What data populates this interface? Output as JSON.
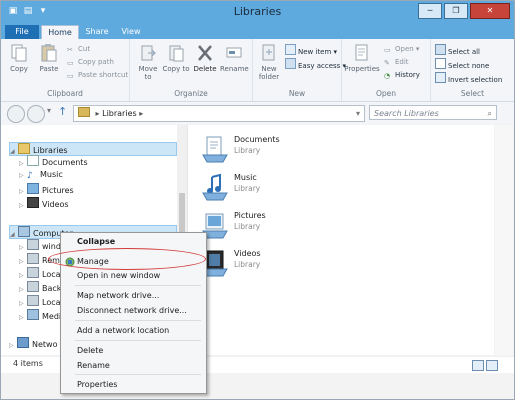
{
  "window": {
    "title": "Libraries"
  },
  "qat": {
    "items": [
      "qat-icon-1",
      "qat-icon-2",
      "qat-icon-3"
    ]
  },
  "window_controls": {
    "minimize": "─",
    "maximize": "❐",
    "close": "✕"
  },
  "tabs": {
    "file": "File",
    "home": "Home",
    "share": "Share",
    "view": "View"
  },
  "ribbon": {
    "clipboard": {
      "label": "Clipboard",
      "copy": "Copy",
      "paste": "Paste",
      "cut": "Cut",
      "copy_path": "Copy path",
      "paste_shortcut": "Paste shortcut"
    },
    "organize": {
      "label": "Organize",
      "move_to": "Move to",
      "copy_to": "Copy to",
      "delete": "Delete",
      "rename": "Rename"
    },
    "new": {
      "label": "New",
      "new_folder": "New folder",
      "new_item": "New item ▾",
      "easy_access": "Easy access ▾"
    },
    "open": {
      "label": "Open",
      "properties": "Properties",
      "open": "Open ▾",
      "edit": "Edit",
      "history": "History"
    },
    "select": {
      "label": "Select",
      "select_all": "Select all",
      "select_none": "Select none",
      "invert_selection": "Invert selection"
    }
  },
  "address": {
    "path": "Libraries",
    "search_placeholder": "Search Libraries"
  },
  "nav": {
    "libraries": "Libraries",
    "documents": "Documents",
    "music": "Music",
    "pictures": "Pictures",
    "videos": "Videos",
    "computer": "Computer",
    "c1": "wind",
    "c2": "Rem",
    "c3": "Loca",
    "c4": "Back",
    "c5": "Loca",
    "c6": "Medi",
    "network": "Netwo"
  },
  "libraries": [
    {
      "name": "Documents",
      "type": "Library"
    },
    {
      "name": "Music",
      "type": "Library"
    },
    {
      "name": "Pictures",
      "type": "Library"
    },
    {
      "name": "Videos",
      "type": "Library"
    }
  ],
  "status": {
    "items_count": "4 items"
  },
  "context_menu": {
    "collapse": "Collapse",
    "manage": "Manage",
    "open_new_window": "Open in new window",
    "map_network_drive": "Map network drive...",
    "disconnect_network_drive": "Disconnect network drive...",
    "add_network_location": "Add a network location",
    "delete": "Delete",
    "rename": "Rename",
    "properties": "Properties"
  }
}
